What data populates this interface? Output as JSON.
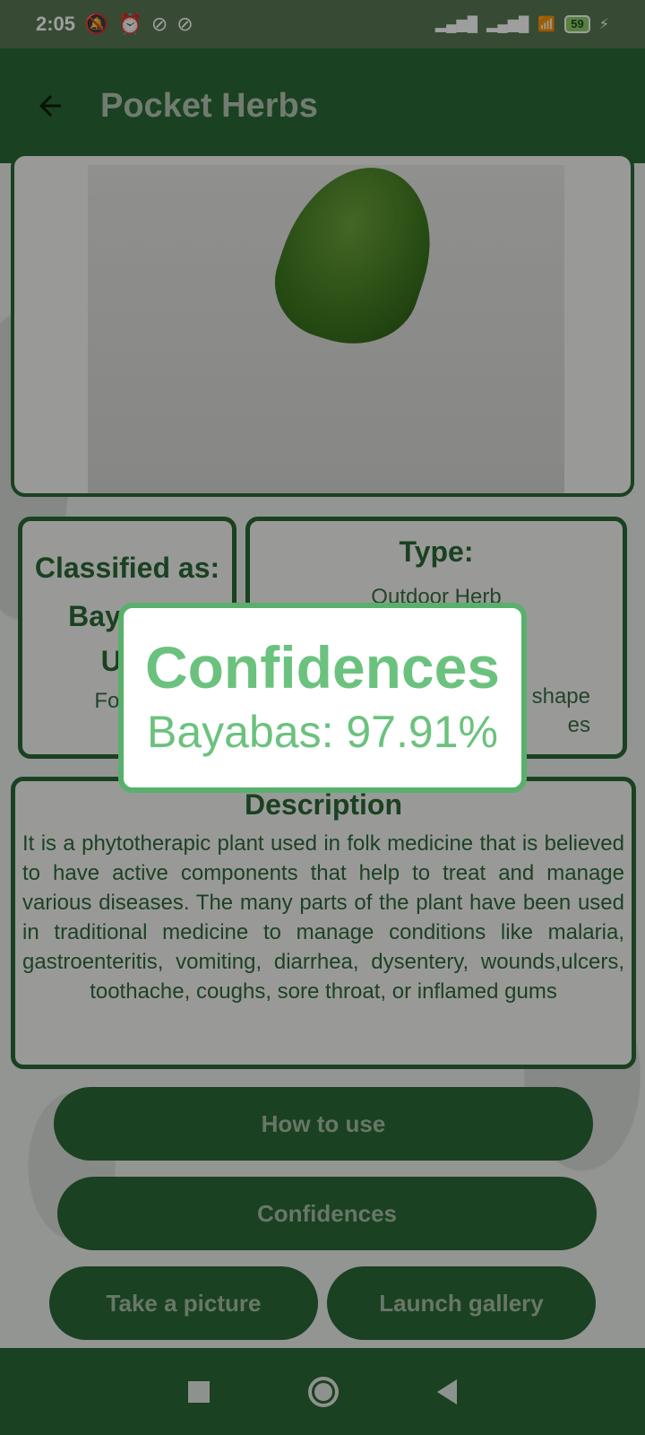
{
  "status_bar": {
    "time": "2:05",
    "battery": "59",
    "icons_left": [
      "bell-off-icon",
      "alarm-icon",
      "sync-icon",
      "sync-icon"
    ],
    "icons_right": [
      "signal-icon",
      "signal-icon",
      "wifi-icon",
      "battery-icon",
      "charging-icon"
    ]
  },
  "app_bar": {
    "title": "Pocket Herbs",
    "back_icon": "arrow-left-icon"
  },
  "classified_card": {
    "heading": "Classified as:",
    "value_line1": "Bayabas",
    "value_line2": "Use",
    "value_detail": "For Co"
  },
  "type_card": {
    "heading": "Type:",
    "value": "Outdoor Herb",
    "detail_line1": "shape",
    "detail_line2": "es"
  },
  "description_card": {
    "heading": "Description",
    "text": "It is a phytotherapic plant used in folk medicine that is believed to have active components that help to treat and manage various diseases. The many parts of the plant have been used in traditional medicine to manage conditions like malaria, gastroenteritis, vomiting, diarrhea, dysentery, wounds,ulcers, toothache, coughs, sore throat, or inflamed gums"
  },
  "buttons": {
    "how_to_use": "How to use",
    "confidences": "Confidences",
    "take_picture": "Take a picture",
    "launch_gallery": "Launch gallery"
  },
  "dialog": {
    "title": "Confidences",
    "result": "Bayabas: 97.91%"
  },
  "colors": {
    "primary": "#2b6a36",
    "accent": "#6bc27e",
    "dialog_border": "#58b06c"
  }
}
